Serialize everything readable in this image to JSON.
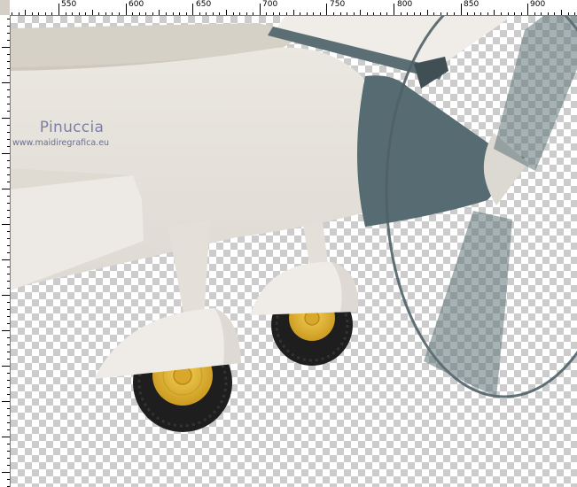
{
  "ruler": {
    "labels": [
      "550",
      "600",
      "650",
      "700",
      "750",
      "800",
      "850",
      "900"
    ]
  },
  "canvas": {
    "background": "transparency-checkerboard",
    "colors": {
      "body": "#e6e2dc",
      "body_shade": "#d3cec4",
      "nose_cone": "#566b72",
      "propeller": "#4f6268",
      "tire": "#1e1e1e",
      "hub": "#e1b436"
    }
  },
  "watermark": {
    "name": "Pinuccia",
    "url": "www.maidiregrafica.eu"
  }
}
